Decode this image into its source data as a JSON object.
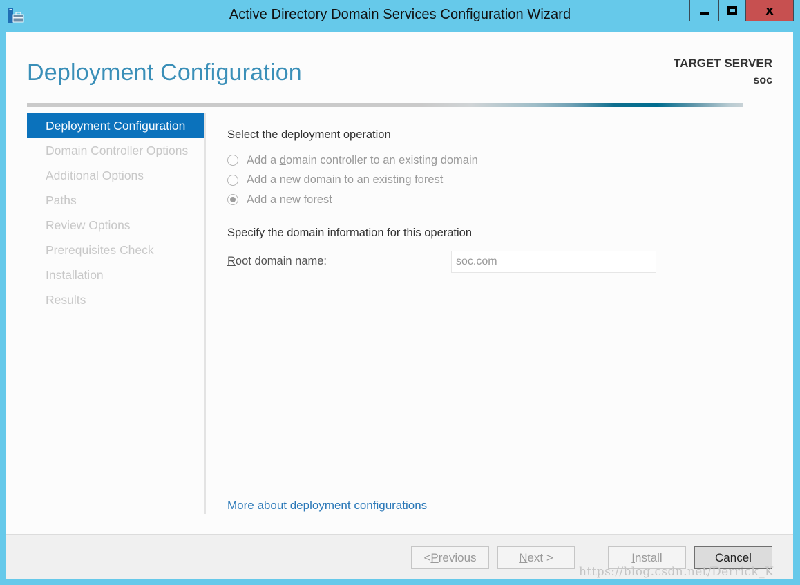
{
  "window": {
    "title": "Active Directory Domain Services Configuration Wizard",
    "icon": "server-toolbox-icon",
    "controls": {
      "minimize": "minimize-icon",
      "maximize": "maximize-icon",
      "close_label": "x"
    }
  },
  "header": {
    "page_title": "Deployment Configuration",
    "target_server_label": "TARGET SERVER",
    "target_server_value": "soc"
  },
  "colors": {
    "titlebar": "#66c9ea",
    "accent": "#0b72bc",
    "heading": "#3a8fb8",
    "link": "#2a78b8",
    "close_button": "#c75050"
  },
  "sidebar": {
    "items": [
      {
        "label": "Deployment Configuration",
        "active": true
      },
      {
        "label": "Domain Controller Options",
        "active": false
      },
      {
        "label": "Additional Options",
        "active": false
      },
      {
        "label": "Paths",
        "active": false
      },
      {
        "label": "Review Options",
        "active": false
      },
      {
        "label": "Prerequisites Check",
        "active": false
      },
      {
        "label": "Installation",
        "active": false
      },
      {
        "label": "Results",
        "active": false
      }
    ]
  },
  "main": {
    "operation_heading": "Select the deployment operation",
    "operations": [
      {
        "pre": "Add a ",
        "key": "d",
        "post": "omain controller to an existing domain",
        "selected": false
      },
      {
        "pre": "Add a new domain to an ",
        "key": "e",
        "post": "xisting forest",
        "selected": false
      },
      {
        "pre": "Add a new ",
        "key": "f",
        "post": "orest",
        "selected": true
      }
    ],
    "domain_heading": "Specify the domain information for this operation",
    "root_domain": {
      "label_key": "R",
      "label_rest": "oot domain name:",
      "value": "soc.com"
    },
    "more_link": "More about deployment configurations"
  },
  "footer": {
    "previous": {
      "pre": "< ",
      "key": "P",
      "post": "revious"
    },
    "next": {
      "pre": "",
      "key": "N",
      "post": "ext >"
    },
    "install": {
      "pre": "",
      "key": "I",
      "post": "nstall"
    },
    "cancel": "Cancel"
  },
  "watermark": "https://blog.csdn.net/Derrick_K"
}
